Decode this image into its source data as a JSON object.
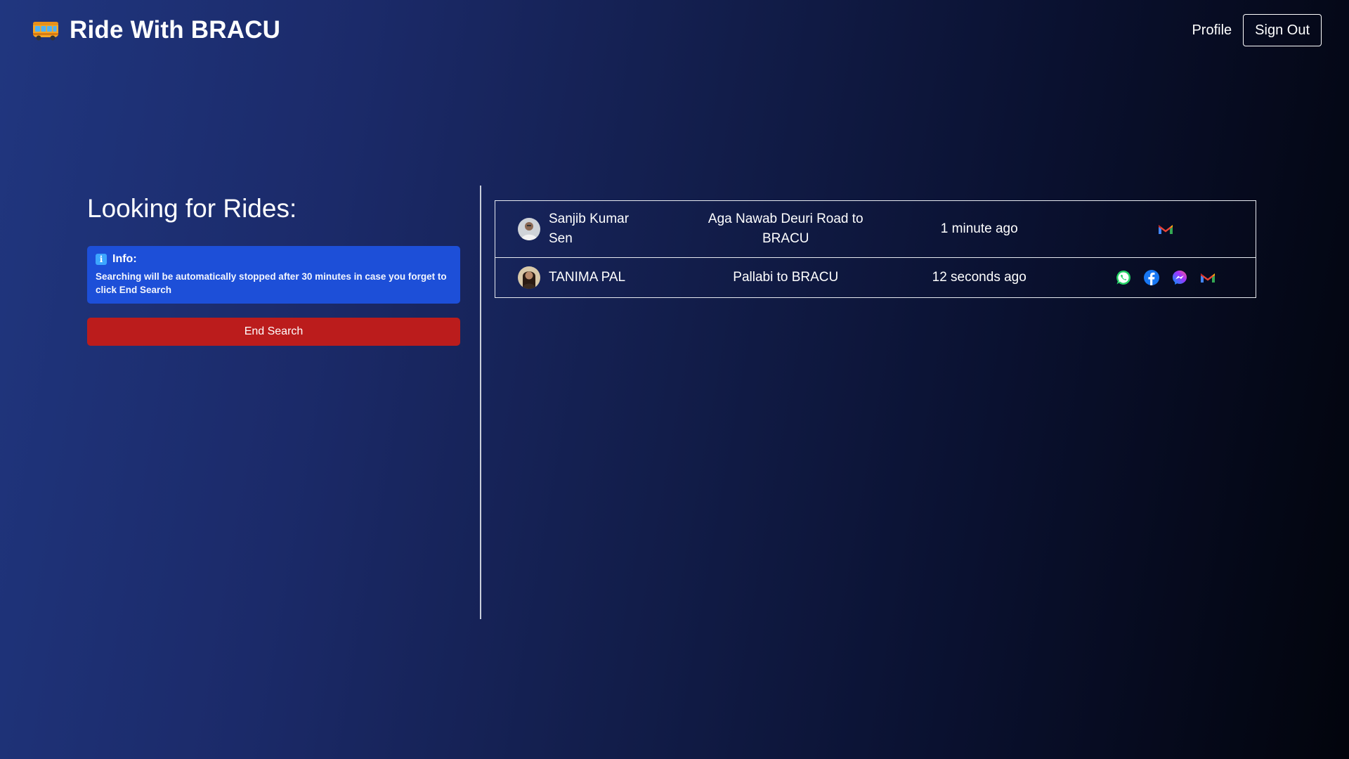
{
  "header": {
    "brand_title": "Ride With BRACU",
    "brand_icon": "bus-icon",
    "nav": {
      "profile_label": "Profile",
      "signout_label": "Sign Out"
    }
  },
  "left_panel": {
    "title": "Looking for Rides:",
    "info": {
      "label": "Info:",
      "icon": "info-icon",
      "text": "Searching will be automatically stopped after 30 minutes in case you forget to click End Search"
    },
    "end_search_label": "End Search"
  },
  "rides": [
    {
      "name": "Sanjib Kumar Sen",
      "route": "Aga Nawab Deuri Road to BRACU",
      "time": "1 minute ago",
      "contacts": [
        "gmail-icon"
      ]
    },
    {
      "name": "TANIMA PAL",
      "route": "Pallabi to BRACU",
      "time": "12 seconds ago",
      "contacts": [
        "whatsapp-icon",
        "facebook-icon",
        "messenger-icon",
        "gmail-icon"
      ]
    }
  ],
  "colors": {
    "info_bg": "#1d4fd8",
    "end_button_bg": "#bb1c1c",
    "whatsapp": "#25d366",
    "facebook": "#1877f2"
  }
}
